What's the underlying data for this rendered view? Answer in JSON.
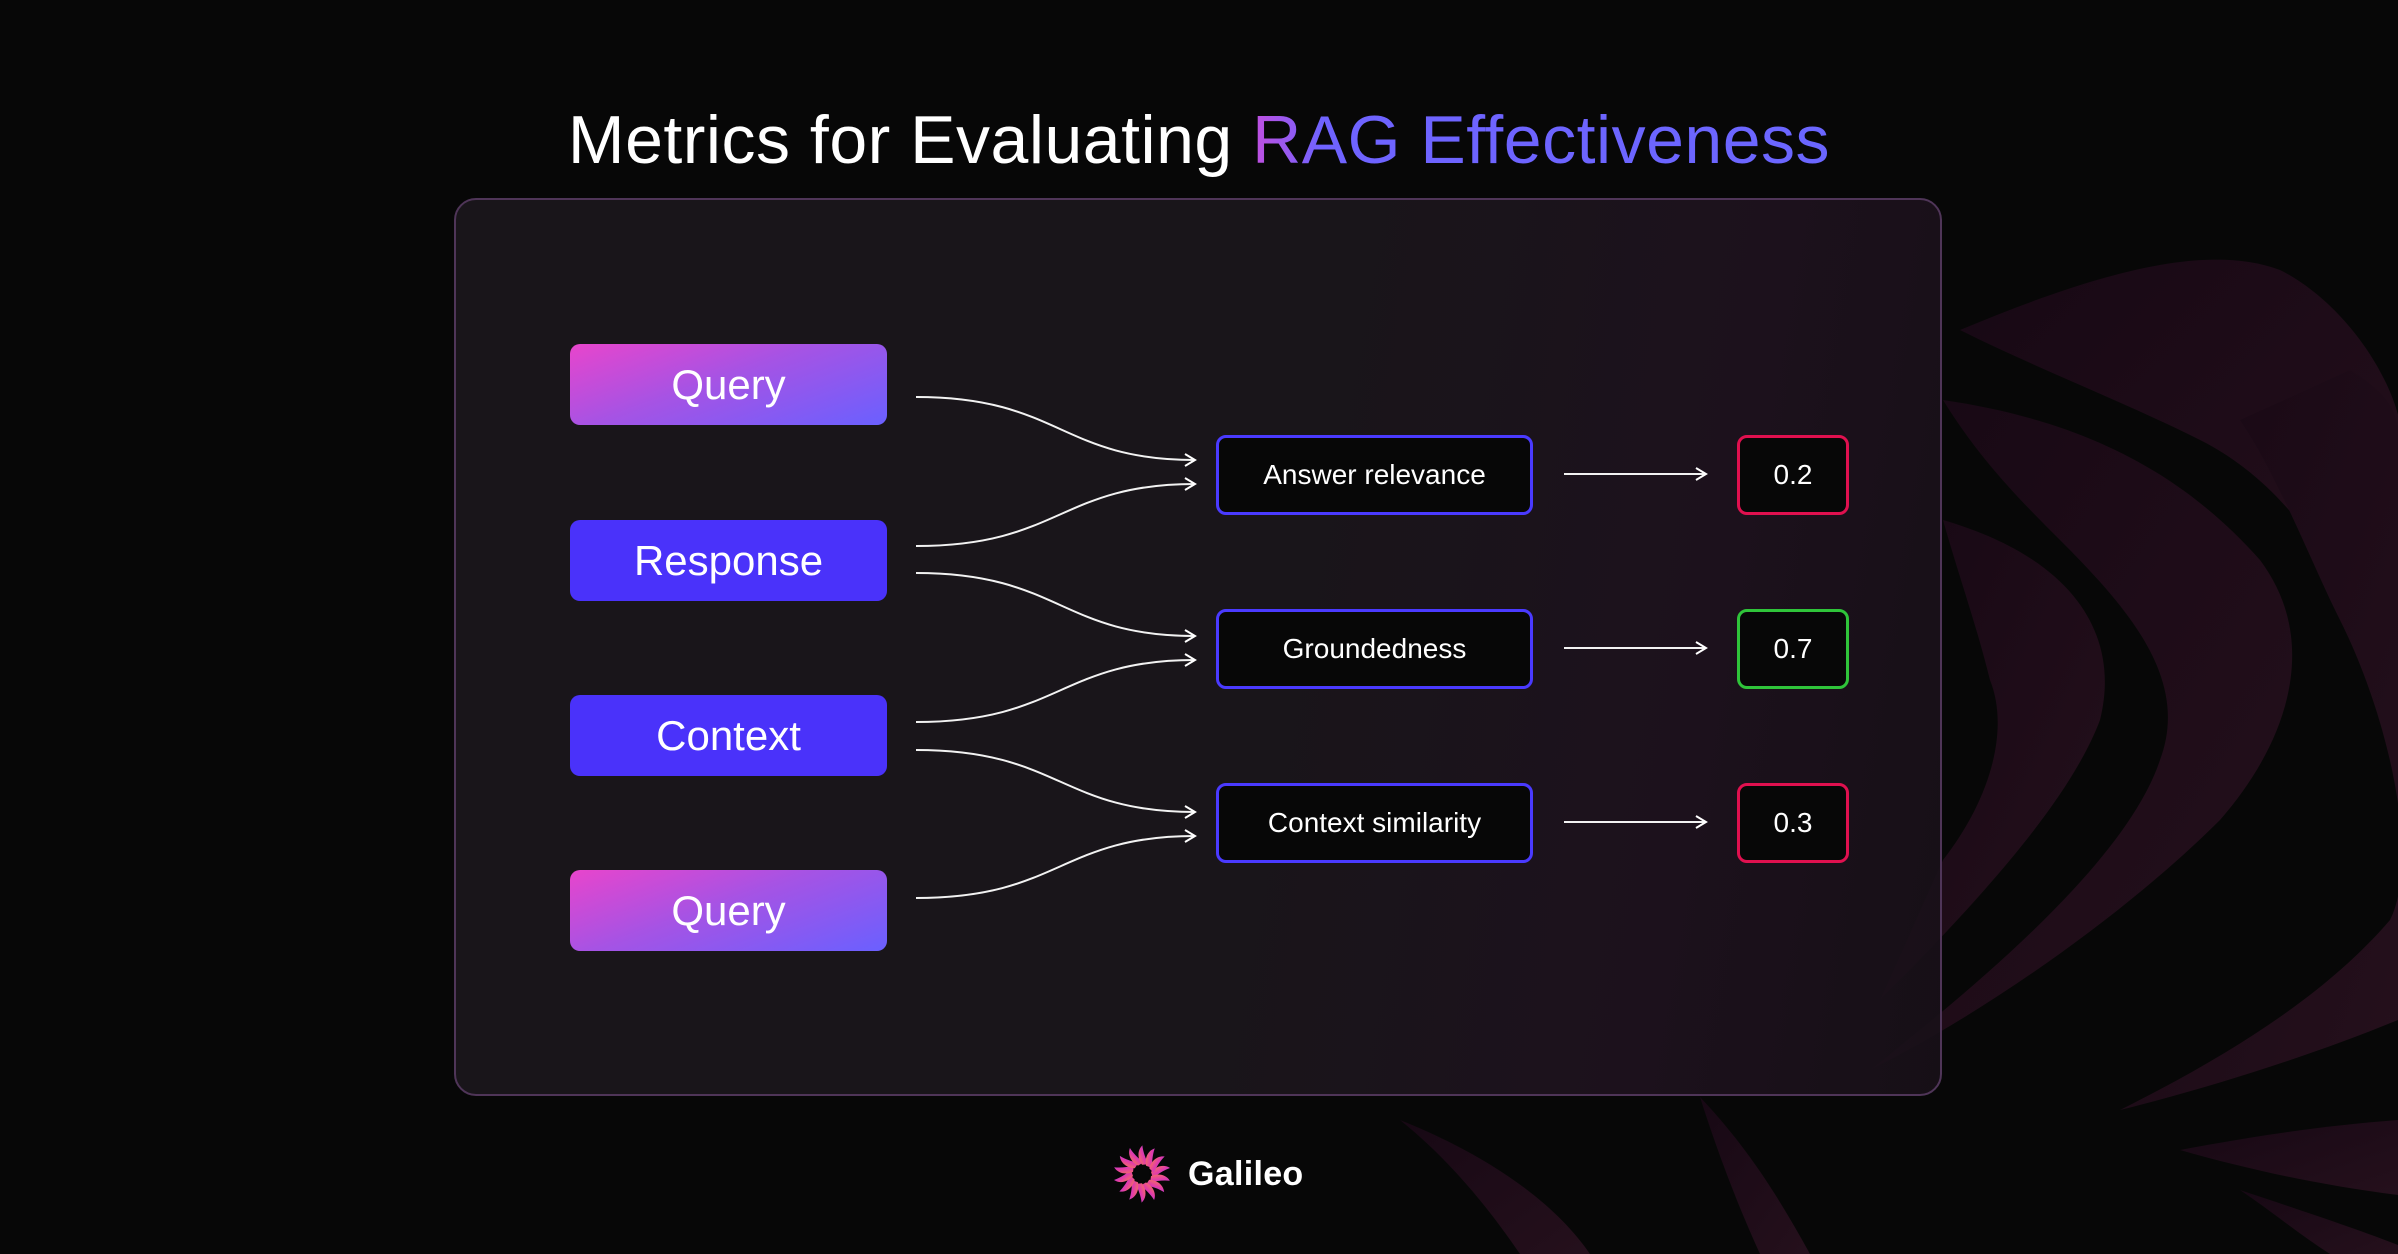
{
  "title": {
    "prefix": "Metrics for Evaluating ",
    "accent": "RAG Effectiveness"
  },
  "colors": {
    "background": "#070707",
    "accent": "#6b66ff",
    "source_solid": "#4a32fa",
    "metric_border": "#4a3aff",
    "score_bad": "#e0104f",
    "score_good": "#2fc43a"
  },
  "diagram": {
    "inputs": [
      {
        "label": "Query",
        "style": "gradient"
      },
      {
        "label": "Response",
        "style": "solid"
      },
      {
        "label": "Context",
        "style": "solid"
      },
      {
        "label": "Query",
        "style": "gradient"
      }
    ],
    "metrics": [
      {
        "label": "Answer relevance",
        "inputs": [
          "Query",
          "Response"
        ],
        "score": "0.2",
        "status": "bad"
      },
      {
        "label": "Groundedness",
        "inputs": [
          "Response",
          "Context"
        ],
        "score": "0.7",
        "status": "good"
      },
      {
        "label": "Context similarity",
        "inputs": [
          "Context",
          "Query"
        ],
        "score": "0.3",
        "status": "bad"
      }
    ]
  },
  "brand": {
    "name": "Galileo",
    "icon": "galileo-swirl-logo-icon"
  }
}
